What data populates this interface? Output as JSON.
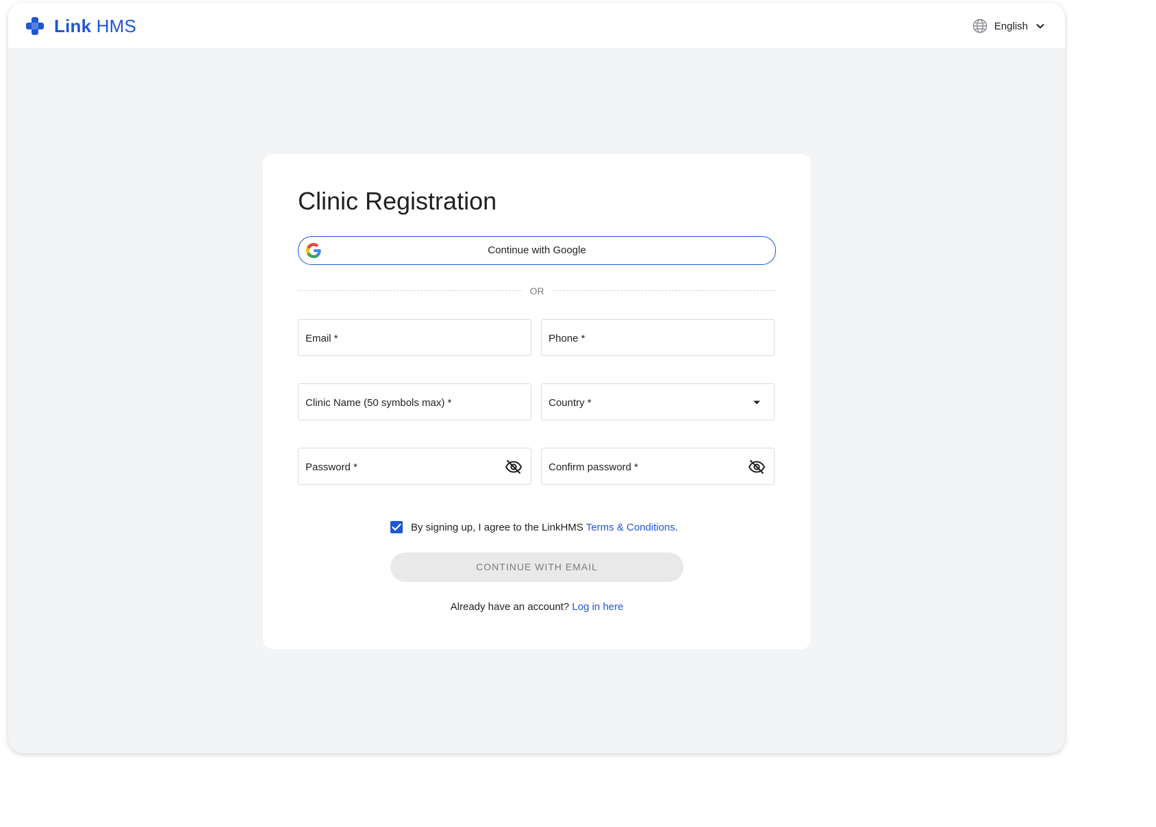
{
  "header": {
    "logo_word_1": "Link",
    "logo_word_2": "HMS",
    "language": "English"
  },
  "form": {
    "title": "Clinic Registration",
    "google_button": "Continue with Google",
    "divider": "OR",
    "fields": {
      "email": "Email *",
      "phone": "Phone *",
      "clinic_name": "Clinic Name (50 symbols max) *",
      "country": "Country *",
      "password": "Password *",
      "confirm_password": "Confirm password *"
    },
    "agreement": {
      "checked": true,
      "text": "By signing up, I agree to the LinkHMS",
      "link": "Terms & Conditions",
      "suffix": "."
    },
    "submit": "CONTINUE WITH EMAIL",
    "login_prompt": "Already have an account?",
    "login_link": "Log in here"
  },
  "colors": {
    "brand": "#1e56d6",
    "background": "#f3f4f6",
    "disabled_button": "#e9e9ea"
  },
  "icons": [
    "plus-cross-logo-icon",
    "globe-icon",
    "chevron-down-icon",
    "google-g-icon",
    "caret-down-icon",
    "eye-off-icon",
    "check-icon"
  ]
}
